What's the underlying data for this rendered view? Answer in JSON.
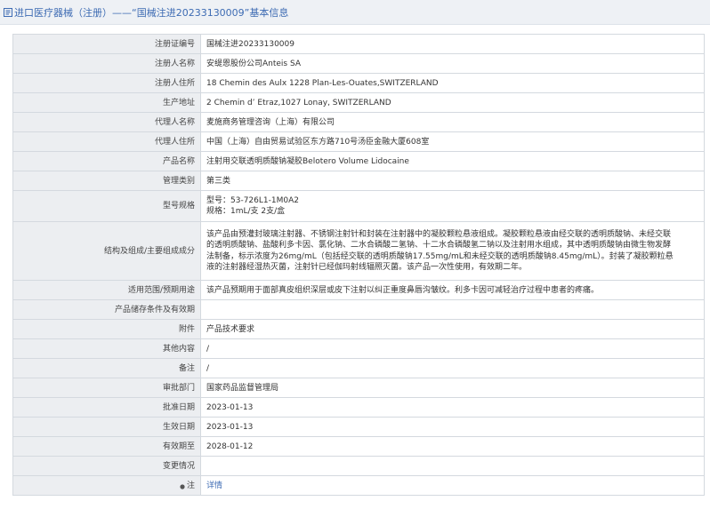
{
  "header": {
    "title": "进口医疗器械（注册）——“国械注进20233130009”基本信息",
    "icon": "document-icon"
  },
  "rows": {
    "reg_no": {
      "label": "注册证编号",
      "value": "国械注进20233130009"
    },
    "registrant": {
      "label": "注册人名称",
      "value": "安缇恩股份公司Anteis SA"
    },
    "registrant_addr": {
      "label": "注册人住所",
      "value": "18 Chemin des Aulx 1228 Plan-Les-Ouates,SWITZERLAND"
    },
    "production_addr": {
      "label": "生产地址",
      "value": "2 Chemin d’ Etraz,1027 Lonay, SWITZERLAND"
    },
    "agent": {
      "label": "代理人名称",
      "value": "麦施商务管理咨询（上海）有限公司"
    },
    "agent_addr": {
      "label": "代理人住所",
      "value": "中国（上海）自由贸易试验区东方路710号汤臣金融大厦608室"
    },
    "product_name": {
      "label": "产品名称",
      "value": "注射用交联透明质酸钠凝胶Belotero Volume Lidocaine"
    },
    "category": {
      "label": "管理类别",
      "value": "第三类"
    },
    "model": {
      "label": "型号规格",
      "line1": "型号：53-726L1-1M0A2",
      "line2": "规格：1mL/支 2支/盒"
    },
    "structure": {
      "label": "结构及组成/主要组成成分",
      "line1": "该产品由预灌封玻璃注射器、不锈钢注射针和封装在注射器中的凝胶颗粒悬液组成。凝胶颗粒悬液由经交联的透明质酸钠、未经交联",
      "line2": "的透明质酸钠、盐酸利多卡因、氯化钠、二水合磷酸二氢钠、十二水合磷酸氢二钠以及注射用水组成，其中透明质酸钠由微生物发酵",
      "line3": "法制备，标示浓度为26mg/mL（包括经交联的透明质酸钠17.55mg/mL和未经交联的透明质酸钠8.45mg/mL）。封装了凝胶颗粒悬",
      "line4": "液的注射器经湿热灭菌，注射针已经伽玛射线辐照灭菌。该产品一次性使用，有效期二年。"
    },
    "scope": {
      "label": "适用范围/预期用途",
      "value": "该产品预期用于面部真皮组织深层或皮下注射以纠正重度鼻唇沟皱纹。利多卡因可减轻治疗过程中患者的疼痛。"
    },
    "storage": {
      "label": "产品储存条件及有效期",
      "value": ""
    },
    "attachment": {
      "label": "附件",
      "value": "产品技术要求"
    },
    "other": {
      "label": "其他内容",
      "value": "/"
    },
    "remark": {
      "label": "备注",
      "value": "/"
    },
    "dept": {
      "label": "审批部门",
      "value": "国家药品监督管理局"
    },
    "approval_date": {
      "label": "批准日期",
      "value": "2023-01-13"
    },
    "effective_date": {
      "label": "生效日期",
      "value": "2023-01-13"
    },
    "expiry": {
      "label": "有效期至",
      "value": "2028-01-12"
    },
    "changes": {
      "label": "变更情况",
      "value": ""
    },
    "note": {
      "label": "注",
      "value": "详情",
      "icon": "info-dot-icon"
    }
  }
}
